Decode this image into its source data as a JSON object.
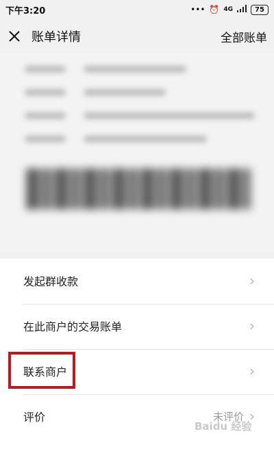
{
  "status_bar": {
    "time": "下午3:20",
    "icons": [
      "dots-icon",
      "alarm-icon",
      "network-4g-icon",
      "signal-icon"
    ],
    "network_label": "4G",
    "battery": "75"
  },
  "header": {
    "title": "账单详情",
    "right_link": "全部账单"
  },
  "list": {
    "items": [
      {
        "label": "发起群收款"
      },
      {
        "label": "在此商户的交易账单"
      },
      {
        "label": "联系商户"
      },
      {
        "label": "评价",
        "value": "未评价"
      }
    ]
  },
  "watermark": "Baidu 经验",
  "colors": {
    "highlight": "#c0171a",
    "background": "#f1f1f1",
    "list_bg": "#ffffff"
  }
}
